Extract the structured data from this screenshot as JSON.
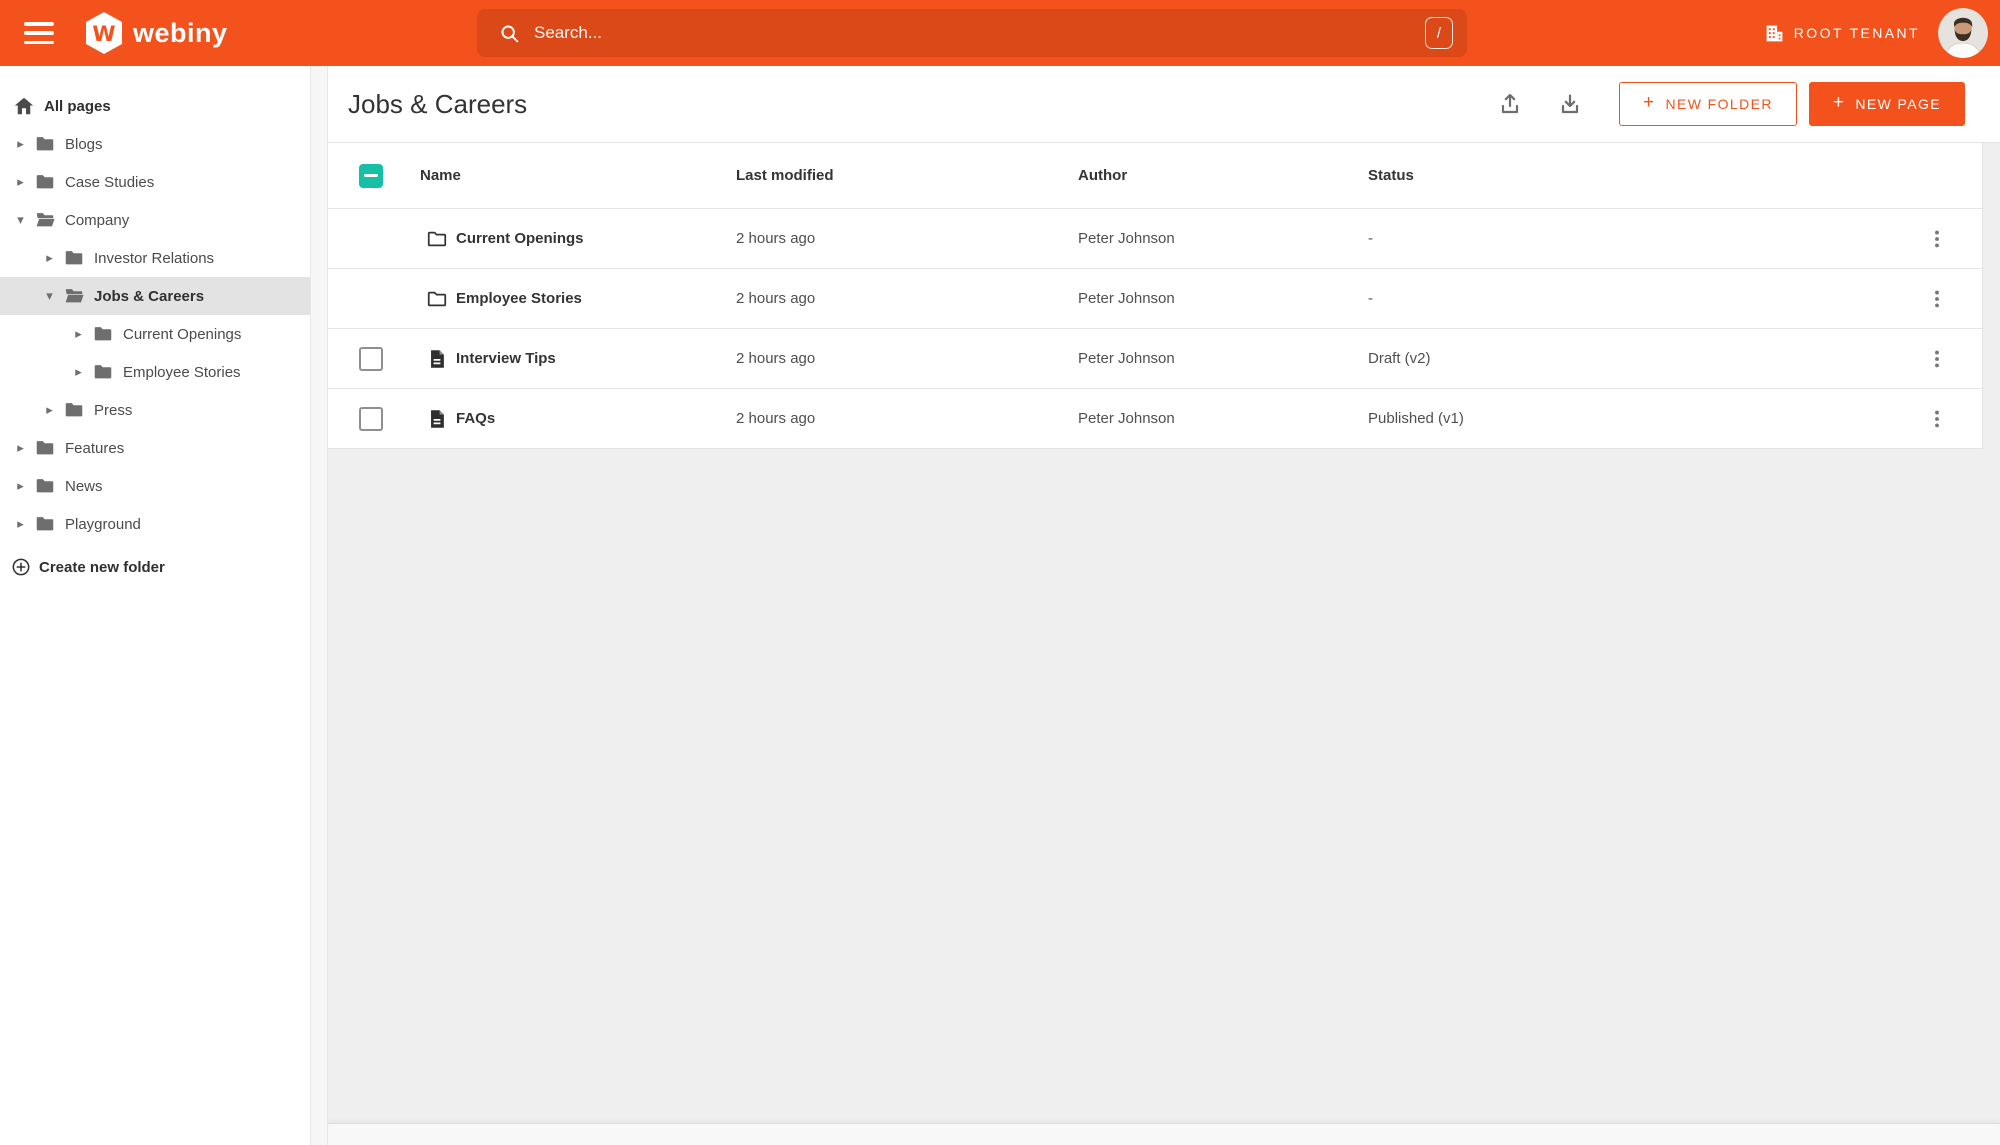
{
  "topbar": {
    "brand": "webiny",
    "search": {
      "placeholder": "Search...",
      "shortcut_key": "/"
    },
    "tenant": {
      "label": "ROOT TENANT"
    }
  },
  "sidebar": {
    "home": {
      "label": "All pages"
    },
    "tree": [
      {
        "label": "Blogs",
        "level": 1,
        "expanded": false,
        "selected": false
      },
      {
        "label": "Case Studies",
        "level": 1,
        "expanded": false,
        "selected": false
      },
      {
        "label": "Company",
        "level": 1,
        "expanded": true,
        "selected": false
      },
      {
        "label": "Investor Relations",
        "level": 2,
        "expanded": false,
        "selected": false
      },
      {
        "label": "Jobs & Careers",
        "level": 2,
        "expanded": true,
        "selected": true
      },
      {
        "label": "Current Openings",
        "level": 3,
        "expanded": false,
        "selected": false
      },
      {
        "label": "Employee Stories",
        "level": 3,
        "expanded": false,
        "selected": false
      },
      {
        "label": "Press",
        "level": 2,
        "expanded": false,
        "selected": false
      },
      {
        "label": "Features",
        "level": 1,
        "expanded": false,
        "selected": false
      },
      {
        "label": "News",
        "level": 1,
        "expanded": false,
        "selected": false
      },
      {
        "label": "Playground",
        "level": 1,
        "expanded": false,
        "selected": false
      }
    ],
    "create_folder_label": "Create new folder"
  },
  "main": {
    "title": "Jobs & Careers",
    "buttons": {
      "plus": "+",
      "new_folder": "NEW FOLDER",
      "new_page": "NEW PAGE"
    },
    "table": {
      "columns": [
        "Name",
        "Last modified",
        "Author",
        "Status"
      ],
      "header_checkbox_state": "indeterminate",
      "rows": [
        {
          "type": "folder",
          "name": "Current Openings",
          "last_modified": "2 hours ago",
          "author": "Peter Johnson",
          "status": "-",
          "has_checkbox": false,
          "checked": false
        },
        {
          "type": "folder",
          "name": "Employee Stories",
          "last_modified": "2 hours ago",
          "author": "Peter Johnson",
          "status": "-",
          "has_checkbox": false,
          "checked": false
        },
        {
          "type": "page",
          "name": "Interview Tips",
          "last_modified": "2 hours ago",
          "author": "Peter Johnson",
          "status": "Draft (v2)",
          "has_checkbox": true,
          "checked": false
        },
        {
          "type": "page",
          "name": "FAQs",
          "last_modified": "2 hours ago",
          "author": "Peter Johnson",
          "status": "Published (v1)",
          "has_checkbox": true,
          "checked": false
        }
      ]
    }
  },
  "glyphs": {
    "collapsed_arrow": "▸",
    "expanded_arrow": "▾"
  },
  "colors": {
    "accent_orange": "#f4521c",
    "checkbox_teal": "#16bfa5"
  }
}
